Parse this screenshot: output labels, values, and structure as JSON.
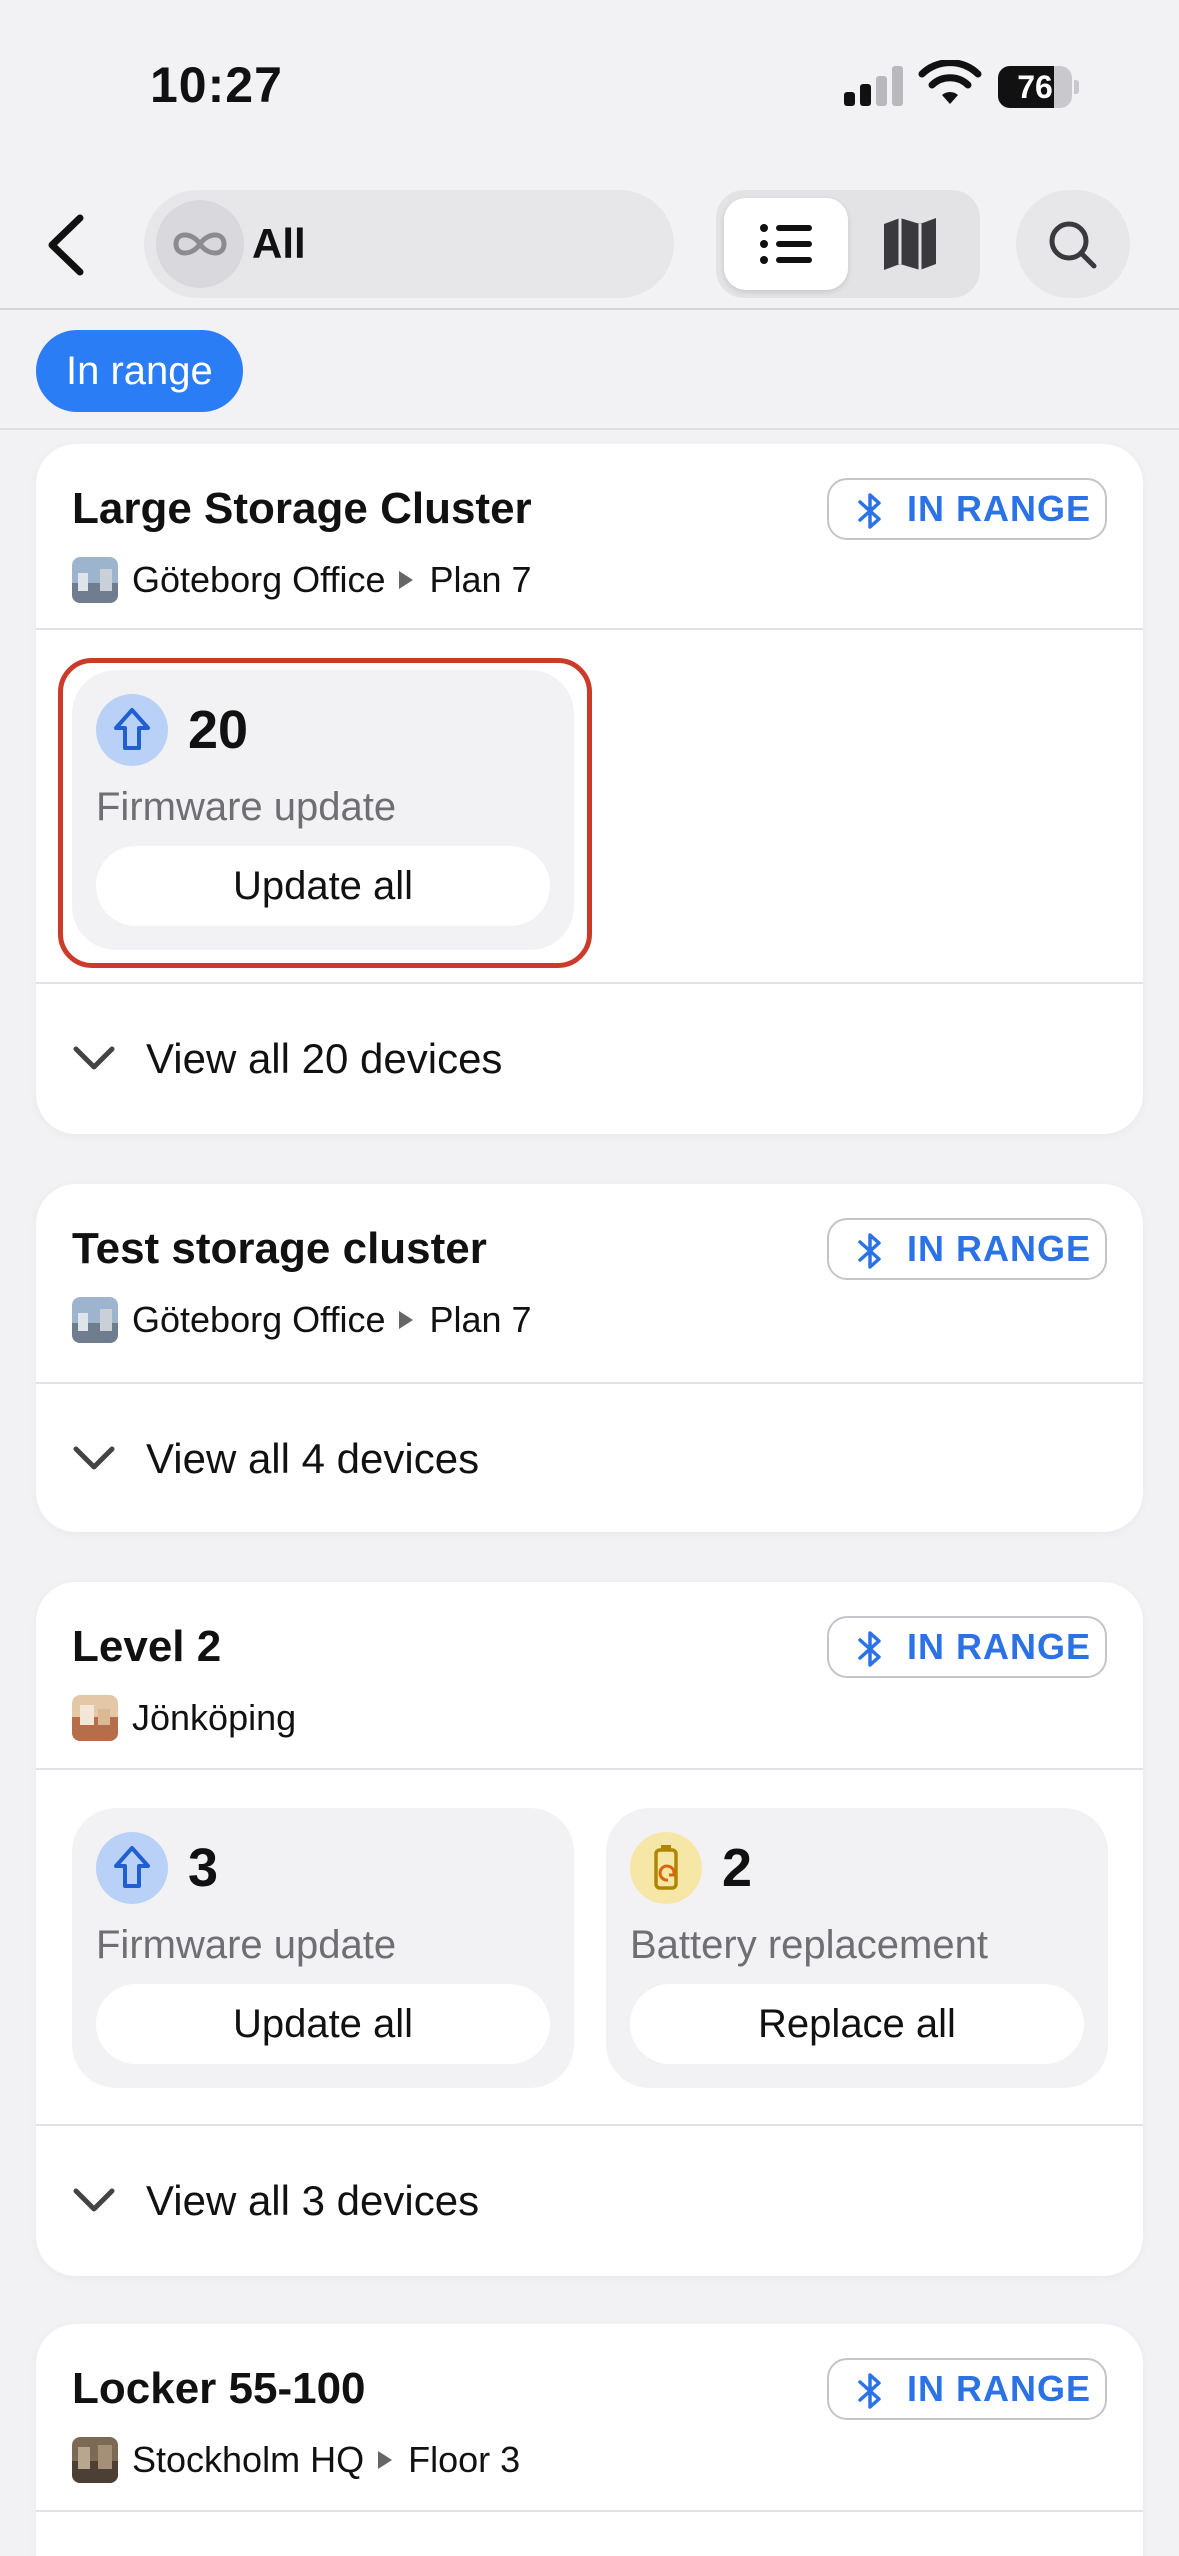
{
  "status_bar": {
    "time": "10:27",
    "battery": "76",
    "battery_level": 0.76
  },
  "nav": {
    "scope_label": "All"
  },
  "filter": {
    "chip_label": "In range"
  },
  "cards": [
    {
      "title": "Large Storage Cluster",
      "badge": "IN RANGE",
      "location": "Göteborg Office",
      "sublocation": "Plan 7",
      "actions": [
        {
          "count": "20",
          "kind": "Firmware update",
          "button": "Update all"
        }
      ],
      "view_all": "View all 20 devices"
    },
    {
      "title": "Test storage cluster",
      "badge": "IN RANGE",
      "location": "Göteborg Office",
      "sublocation": "Plan 7",
      "view_all": "View all 4 devices"
    },
    {
      "title": "Level 2",
      "badge": "IN RANGE",
      "location": "Jönköping",
      "actions": [
        {
          "count": "3",
          "kind": "Firmware update",
          "button": "Update all"
        },
        {
          "count": "2",
          "kind": "Battery replacement",
          "button": "Replace all"
        }
      ],
      "view_all": "View all 3 devices"
    },
    {
      "title": "Locker 55-100",
      "badge": "IN RANGE",
      "location": "Stockholm HQ",
      "sublocation": "Floor 3"
    }
  ],
  "colors": {
    "accent": "#2a7df4",
    "badge_text": "#2a72e6",
    "highlight": "#cc3b2a",
    "firmware_icon_bg": "#b9d1f7",
    "battery_icon_bg": "#f7e7a6"
  },
  "icons": [
    "back-chevron-icon",
    "infinity-icon",
    "updown-chevron-icon",
    "list-icon",
    "map-icon",
    "search-icon",
    "bluetooth-icon",
    "arrow-up-icon",
    "battery-swap-icon",
    "chevron-down-icon"
  ]
}
